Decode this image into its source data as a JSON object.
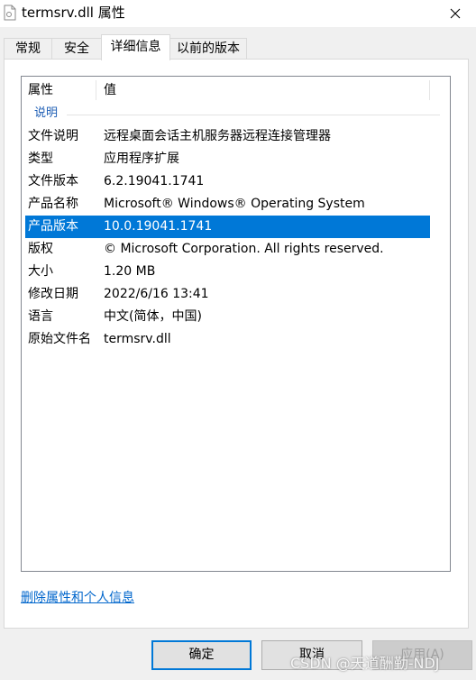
{
  "window": {
    "title": "termsrv.dll 属性",
    "close_glyph": "✕"
  },
  "tabs": [
    {
      "label": "常规"
    },
    {
      "label": "安全"
    },
    {
      "label": "详细信息"
    },
    {
      "label": "以前的版本"
    }
  ],
  "list": {
    "col_property": "属性",
    "col_value": "值",
    "group": "说明",
    "rows": [
      {
        "key": "文件说明",
        "value": "远程桌面会话主机服务器远程连接管理器"
      },
      {
        "key": "类型",
        "value": "应用程序扩展"
      },
      {
        "key": "文件版本",
        "value": "6.2.19041.1741"
      },
      {
        "key": "产品名称",
        "value": "Microsoft® Windows® Operating System"
      },
      {
        "key": "产品版本",
        "value": "10.0.19041.1741"
      },
      {
        "key": "版权",
        "value": "© Microsoft Corporation. All rights reserved."
      },
      {
        "key": "大小",
        "value": "1.20 MB"
      },
      {
        "key": "修改日期",
        "value": "2022/6/16 13:41"
      },
      {
        "key": "语言",
        "value": "中文(简体，中国)"
      },
      {
        "key": "原始文件名",
        "value": "termsrv.dll"
      }
    ],
    "selected_row": "产品版本"
  },
  "remove_link": "删除属性和个人信息",
  "buttons": {
    "ok": "确定",
    "cancel": "取消",
    "apply": "应用(A)"
  },
  "watermark": "CSDN @天道酬勤-NDJ",
  "colors": {
    "selection": "#0078d7",
    "link": "#0066cc",
    "group": "#1e5eb5"
  }
}
